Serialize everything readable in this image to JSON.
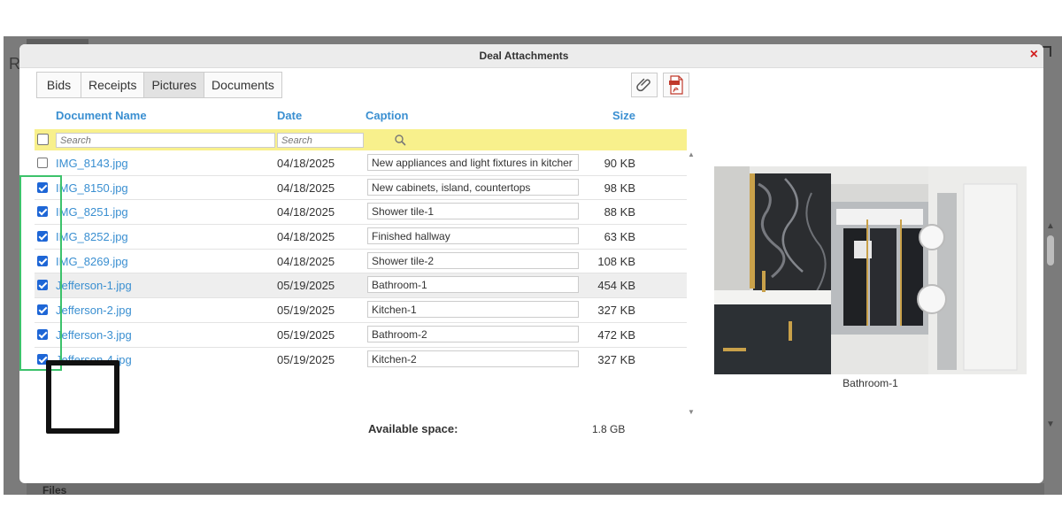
{
  "dialog": {
    "title": "Deal Attachments",
    "close_glyph": "×"
  },
  "tabs": [
    {
      "label": "Bids",
      "active": false
    },
    {
      "label": "Receipts",
      "active": false
    },
    {
      "label": "Pictures",
      "active": true
    },
    {
      "label": "Documents",
      "active": false
    }
  ],
  "toolbar": {
    "attach_icon": "paperclip-icon",
    "pdf_icon": "pdf-icon"
  },
  "columns": {
    "name": "Document Name",
    "date": "Date",
    "caption": "Caption",
    "size": "Size"
  },
  "filters": {
    "name_placeholder": "Search",
    "date_placeholder": "Search"
  },
  "rows": [
    {
      "checked": false,
      "name": "IMG_8143.jpg",
      "date": "04/18/2025",
      "caption": "New appliances and light fixtures in kitcher",
      "size": "90 KB"
    },
    {
      "checked": true,
      "name": "IMG_8150.jpg",
      "date": "04/18/2025",
      "caption": "New cabinets, island, countertops",
      "size": "98 KB"
    },
    {
      "checked": true,
      "name": "IMG_8251.jpg",
      "date": "04/18/2025",
      "caption": "Shower tile-1",
      "size": "88 KB"
    },
    {
      "checked": true,
      "name": "IMG_8252.jpg",
      "date": "04/18/2025",
      "caption": "Finished hallway",
      "size": "63 KB"
    },
    {
      "checked": true,
      "name": "IMG_8269.jpg",
      "date": "04/18/2025",
      "caption": "Shower tile-2",
      "size": "108 KB"
    },
    {
      "checked": true,
      "name": "Jefferson-1.jpg",
      "date": "05/19/2025",
      "caption": "Bathroom-1",
      "size": "454 KB",
      "highlight": true
    },
    {
      "checked": true,
      "name": "Jefferson-2.jpg",
      "date": "05/19/2025",
      "caption": "Kitchen-1",
      "size": "327 KB"
    },
    {
      "checked": true,
      "name": "Jefferson-3.jpg",
      "date": "05/19/2025",
      "caption": "Bathroom-2",
      "size": "472 KB"
    },
    {
      "checked": true,
      "name": "Jefferson-4.jpg",
      "date": "05/19/2025",
      "caption": "Kitchen-2",
      "size": "327 KB"
    }
  ],
  "footer": {
    "available_label": "Available space:",
    "available_value": "1.8 GB"
  },
  "preview": {
    "caption": "Bathroom-1"
  },
  "background": {
    "left_letter": "R",
    "files_label": "Files"
  },
  "colors": {
    "link": "#3a8fd1",
    "filter_bg": "#f8f08c",
    "close": "#d21e1e",
    "checkbox": "#1e66d6",
    "annotation_green": "#3cc26b"
  }
}
